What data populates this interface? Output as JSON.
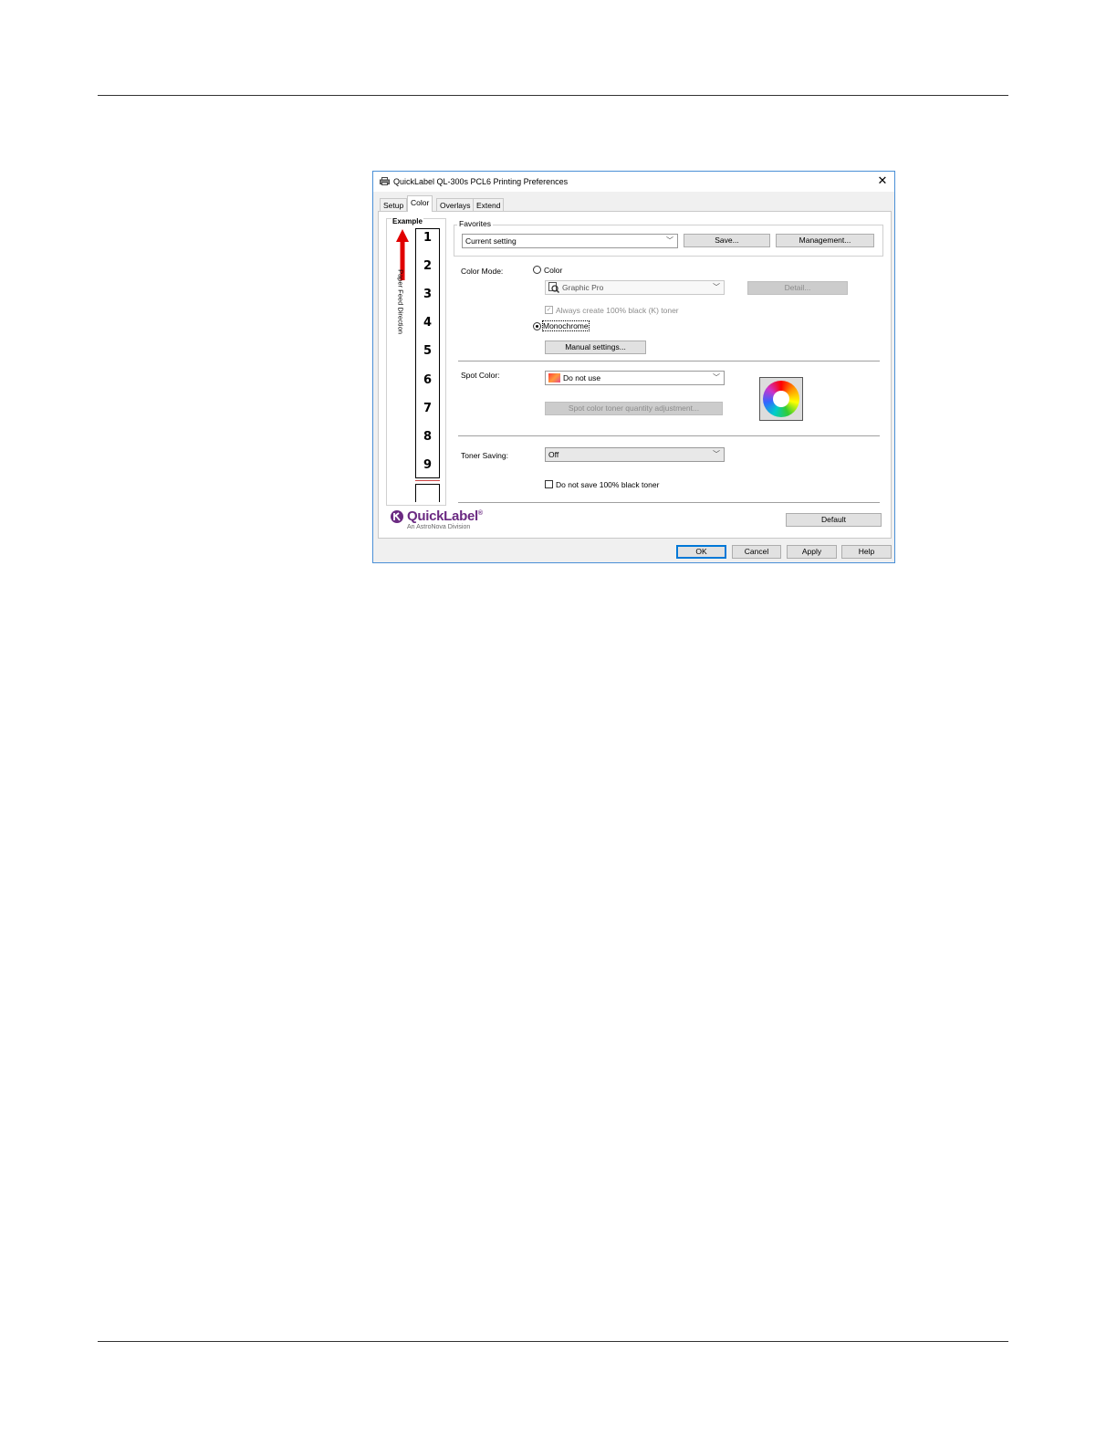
{
  "window": {
    "title": "QuickLabel QL-300s PCL6 Printing Preferences",
    "close_glyph": "✕"
  },
  "tabs": [
    {
      "label": "Setup",
      "active": false
    },
    {
      "label": "Color",
      "active": true
    },
    {
      "label": "Overlays",
      "active": false
    },
    {
      "label": "Extend",
      "active": false
    }
  ],
  "example": {
    "title": "Example",
    "feed_label": "Paper Feed Direction",
    "pages": [
      "1",
      "2",
      "3",
      "4",
      "5",
      "6",
      "7",
      "8",
      "9"
    ],
    "arrow_color": "#e00000"
  },
  "favorites": {
    "legend": "Favorites",
    "selected": "Current setting",
    "save_label": "Save...",
    "management_label": "Management..."
  },
  "color_mode": {
    "label": "Color Mode:",
    "color_option": "Color",
    "color_selected": false,
    "profile_selected": "Graphic Pro",
    "detail_label": "Detail...",
    "always_black_label": "Always create 100% black (K) toner",
    "always_black_checked": true,
    "monochrome_option": "Monochrome",
    "monochrome_selected": true,
    "manual_settings_label": "Manual settings..."
  },
  "spot_color": {
    "label": "Spot Color:",
    "selected": "Do not use",
    "adjust_label": "Spot color toner quantity adjustment..."
  },
  "toner_saving": {
    "label": "Toner Saving:",
    "selected": "Off",
    "no_save_black_label": "Do not save 100% black toner",
    "no_save_black_checked": false
  },
  "logo": {
    "name": "QuickLabel",
    "trademark": "®",
    "subtitle": "An AstroNova Division",
    "color": "#6b2a82"
  },
  "footer": {
    "default_label": "Default",
    "ok_label": "OK",
    "cancel_label": "Cancel",
    "apply_label": "Apply",
    "help_label": "Help"
  },
  "icons": [
    "printer-icon",
    "close-icon",
    "chevron-down-icon",
    "color-profile-icon",
    "spot-color-swatch-icon",
    "color-wheel-icon",
    "quicklabel-logo-icon"
  ]
}
